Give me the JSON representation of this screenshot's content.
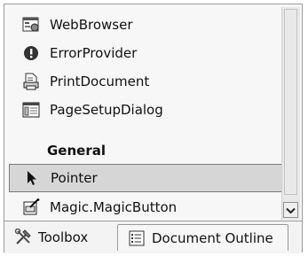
{
  "toolbox": {
    "items": [
      {
        "label": "WebBrowser",
        "icon": "webbrowser-icon"
      },
      {
        "label": "ErrorProvider",
        "icon": "error-icon"
      },
      {
        "label": "PrintDocument",
        "icon": "printer-document-icon"
      },
      {
        "label": "PageSetupDialog",
        "icon": "page-setup-dialog-icon"
      }
    ],
    "group_label": "General",
    "group_items": [
      {
        "label": "Pointer",
        "icon": "pointer-arrow-icon",
        "selected": true
      },
      {
        "label": "Magic.MagicButton",
        "icon": "magic-button-icon"
      }
    ]
  },
  "tabs": [
    {
      "label": "Toolbox",
      "icon": "toolbox-tools-icon"
    },
    {
      "label": "Document Outline",
      "icon": "document-outline-icon"
    }
  ]
}
